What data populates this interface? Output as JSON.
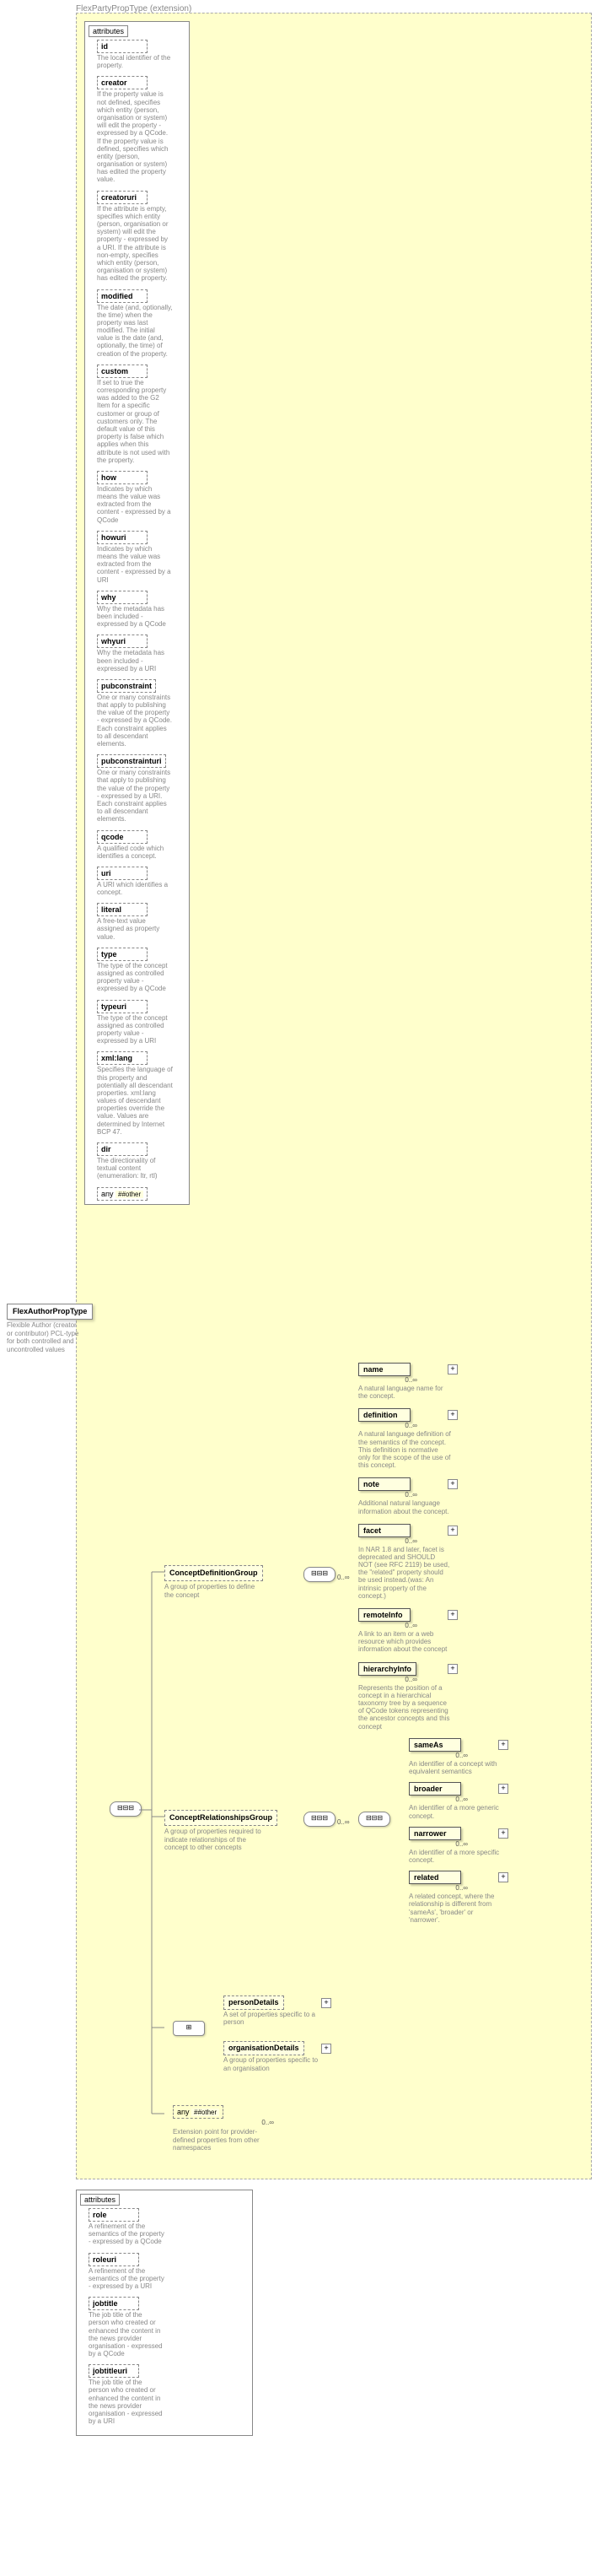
{
  "ext_label": "FlexPartyPropType (extension)",
  "root": {
    "name": "FlexAuthorPropType",
    "desc": "Flexible Author (creator or contributor) PCL-type for both controlled and uncontrolled values"
  },
  "attributes_header": "attributes",
  "main_attrs": [
    {
      "name": "id",
      "desc": "The local identifier of the property."
    },
    {
      "name": "creator",
      "desc": "If the property value is not defined, specifies which entity (person, organisation or system) will edit the property - expressed by a QCode. If the property value is defined, specifies which entity (person, organisation or system) has edited the property value."
    },
    {
      "name": "creatoruri",
      "desc": "If the attribute is empty, specifies which entity (person, organisation or system) will edit the property - expressed by a URI. If the attribute is non-empty, specifies which entity (person, organisation or system) has edited the property."
    },
    {
      "name": "modified",
      "desc": "The date (and, optionally, the time) when the property was last modified. The initial value is the date (and, optionally, the time) of creation of the property."
    },
    {
      "name": "custom",
      "desc": "If set to true the corresponding property was added to the G2 Item for a specific customer or group of customers only. The default value of this property is false which applies when this attribute is not used with the property."
    },
    {
      "name": "how",
      "desc": "Indicates by which means the value was extracted from the content - expressed by a QCode"
    },
    {
      "name": "howuri",
      "desc": "Indicates by which means the value was extracted from the content - expressed by a URI"
    },
    {
      "name": "why",
      "desc": "Why the metadata has been included - expressed by a QCode"
    },
    {
      "name": "whyuri",
      "desc": "Why the metadata has been included - expressed by a URI"
    },
    {
      "name": "pubconstraint",
      "desc": "One or many constraints that apply to publishing the value of the property - expressed by a QCode. Each constraint applies to all descendant elements."
    },
    {
      "name": "pubconstrainturi",
      "desc": "One or many constraints that apply to publishing the value of the property - expressed by a URI. Each constraint applies to all descendant elements."
    },
    {
      "name": "qcode",
      "desc": "A qualified code which identifies a concept."
    },
    {
      "name": "uri",
      "desc": "A URI which identifies a concept."
    },
    {
      "name": "literal",
      "desc": "A free-text value assigned as property value."
    },
    {
      "name": "type",
      "desc": "The type of the concept assigned as controlled property value - expressed by a QCode"
    },
    {
      "name": "typeuri",
      "desc": "The type of the concept assigned as controlled property value - expressed by a URI"
    },
    {
      "name": "xml:lang",
      "desc": "Specifies the language of this property and potentially all descendant properties. xml:lang values of descendant properties override the value. Values are determined by Internet BCP 47."
    },
    {
      "name": "dir",
      "desc": "The directionality of textual content (enumeration: ltr, rtl)"
    }
  ],
  "any_other": "##other",
  "any_label": "any",
  "groups": {
    "concept_def": {
      "label": "ConceptDefinitionGroup",
      "desc": "A group of properties to define the concept"
    },
    "concept_rel": {
      "label": "ConceptRelationshipsGroup",
      "desc": "A group of properties required to indicate relationships of the concept to other concepts"
    }
  },
  "concept_def_children": [
    {
      "name": "name",
      "desc": "A natural language name for the concept."
    },
    {
      "name": "definition",
      "desc": "A natural language definition of the semantics of the concept. This definition is normative only for the scope of the use of this concept."
    },
    {
      "name": "note",
      "desc": "Additional natural language information about the concept."
    },
    {
      "name": "facet",
      "desc": "In NAR 1.8 and later, facet is deprecated and SHOULD NOT (see RFC 2119) be used, the \"related\" property should be used instead.(was: An intrinsic property of the concept.)"
    },
    {
      "name": "remoteInfo",
      "desc": "A link to an item or a web resource which provides information about the concept"
    },
    {
      "name": "hierarchyInfo",
      "desc": "Represents the position of a concept in a hierarchical taxonomy tree by a sequence of QCode tokens representing the ancestor concepts and this concept"
    }
  ],
  "concept_rel_children": [
    {
      "name": "sameAs",
      "desc": "An identifier of a concept with equivalent semantics"
    },
    {
      "name": "broader",
      "desc": "An identifier of a more generic concept."
    },
    {
      "name": "narrower",
      "desc": "An identifier of a more specific concept."
    },
    {
      "name": "related",
      "desc": "A related concept, where the relationship is different from 'sameAs', 'broader' or 'narrower'."
    }
  ],
  "details": [
    {
      "name": "personDetails",
      "desc": "A set of properties specific to a person"
    },
    {
      "name": "organisationDetails",
      "desc": "A group of properties specific to an organisation"
    }
  ],
  "ext_any": {
    "label": "any",
    "ns": "##other",
    "card": "0..∞",
    "desc": "Extension point for provider-defined properties from other namespaces"
  },
  "lower_attrs": [
    {
      "name": "role",
      "desc": "A refinement of the semantics of the property - expressed by a QCode"
    },
    {
      "name": "roleuri",
      "desc": "A refinement of the semantics of the property - expressed by a URI"
    },
    {
      "name": "jobtitle",
      "desc": "The job title of the person who created or enhanced the content in the news provider organisation - expressed by a QCode"
    },
    {
      "name": "jobtitleuri",
      "desc": "The job title of the person who created or enhanced the content in the news provider organisation - expressed by a URI"
    }
  ],
  "card_0_inf": "0..∞"
}
